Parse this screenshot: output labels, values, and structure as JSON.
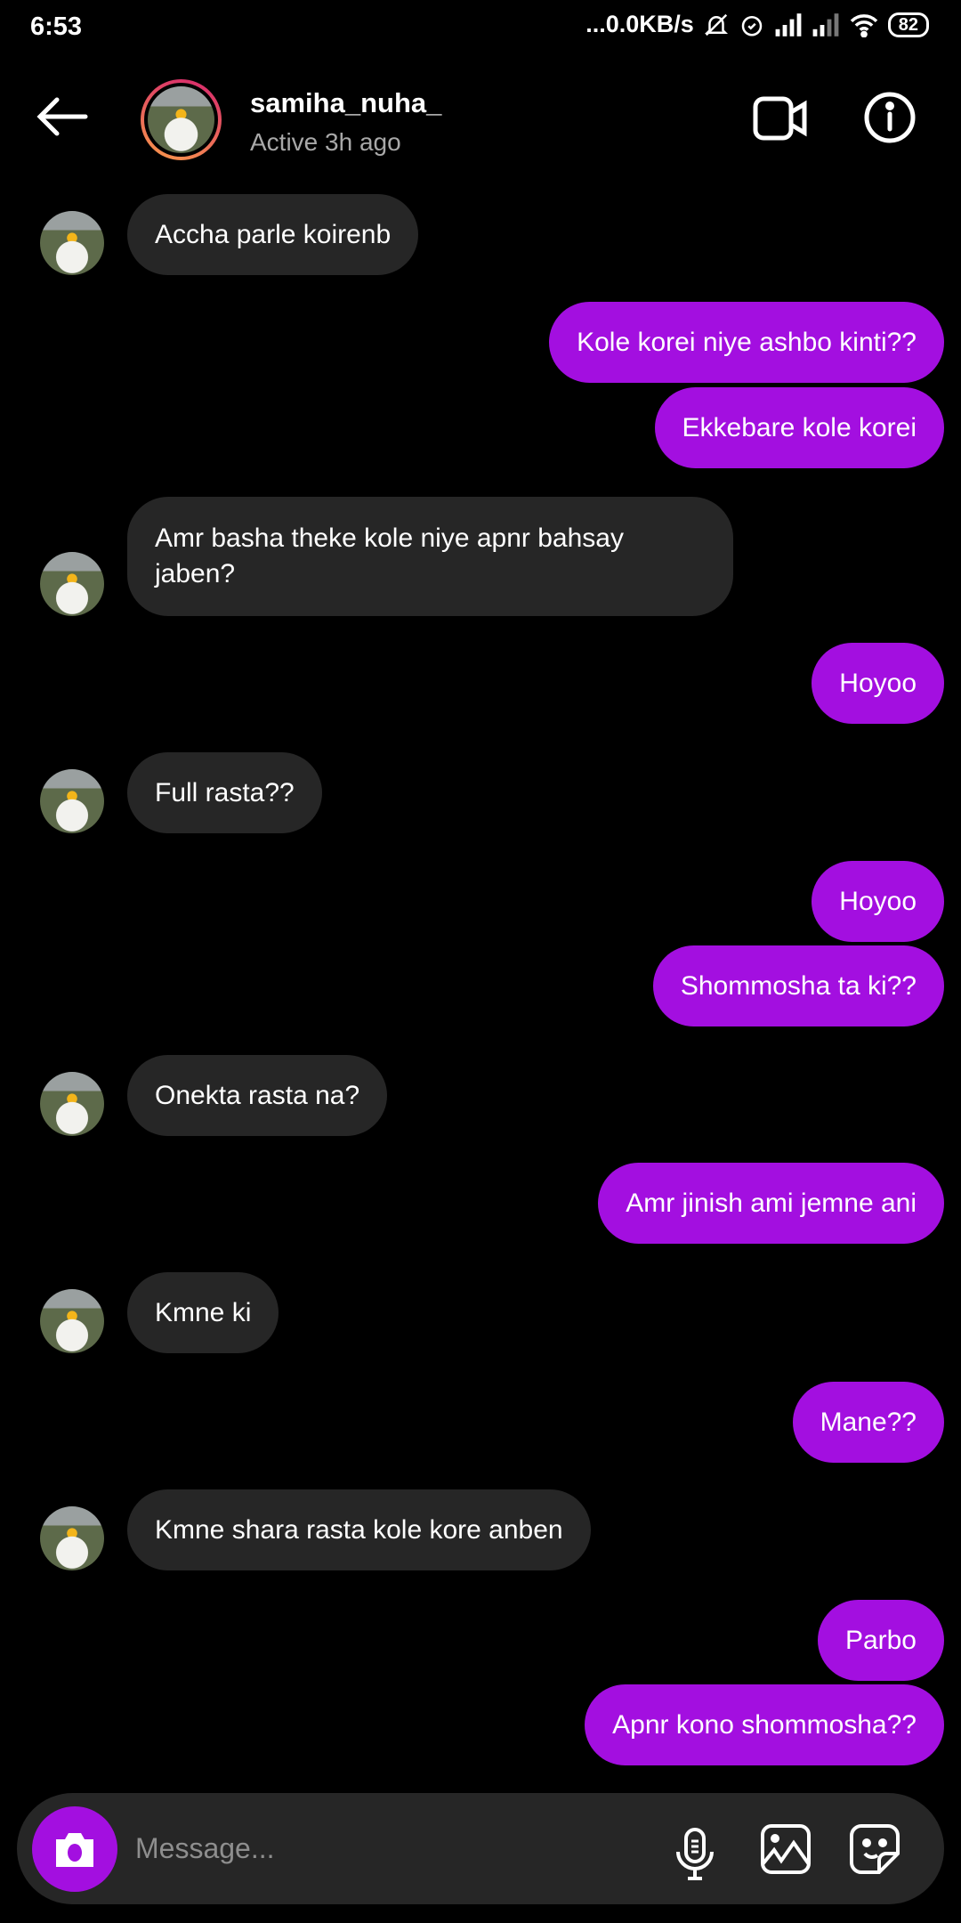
{
  "status_bar": {
    "time": "6:53",
    "network_speed": "...0.0KB/s",
    "battery": "82"
  },
  "header": {
    "username": "samiha_nuha_",
    "status": "Active 3h ago"
  },
  "messages": [
    {
      "from": "them",
      "text": "Accha parle koirenb"
    },
    {
      "from": "me",
      "text": "Kole korei niye ashbo kinti??"
    },
    {
      "from": "me",
      "text": "Ekkebare kole korei"
    },
    {
      "from": "them",
      "text": "Amr basha theke kole niye apnr bahsay jaben?"
    },
    {
      "from": "me",
      "text": "Hoyoo"
    },
    {
      "from": "them",
      "text": "Full rasta??"
    },
    {
      "from": "me",
      "text": "Hoyoo"
    },
    {
      "from": "me",
      "text": "Shommosha ta ki??"
    },
    {
      "from": "them",
      "text": "Onekta rasta na?"
    },
    {
      "from": "me",
      "text": "Amr jinish ami jemne ani"
    },
    {
      "from": "them",
      "text": "Kmne ki"
    },
    {
      "from": "me",
      "text": "Mane??"
    },
    {
      "from": "them",
      "text": "Kmne shara rasta kole kore anben"
    },
    {
      "from": "me",
      "text": "Parbo"
    },
    {
      "from": "me",
      "text": "Apnr kono shommosha??"
    }
  ],
  "composer": {
    "placeholder": "Message..."
  },
  "colors": {
    "sent_bubble": "#a30fe0",
    "received_bubble": "#262626",
    "background": "#000000"
  }
}
